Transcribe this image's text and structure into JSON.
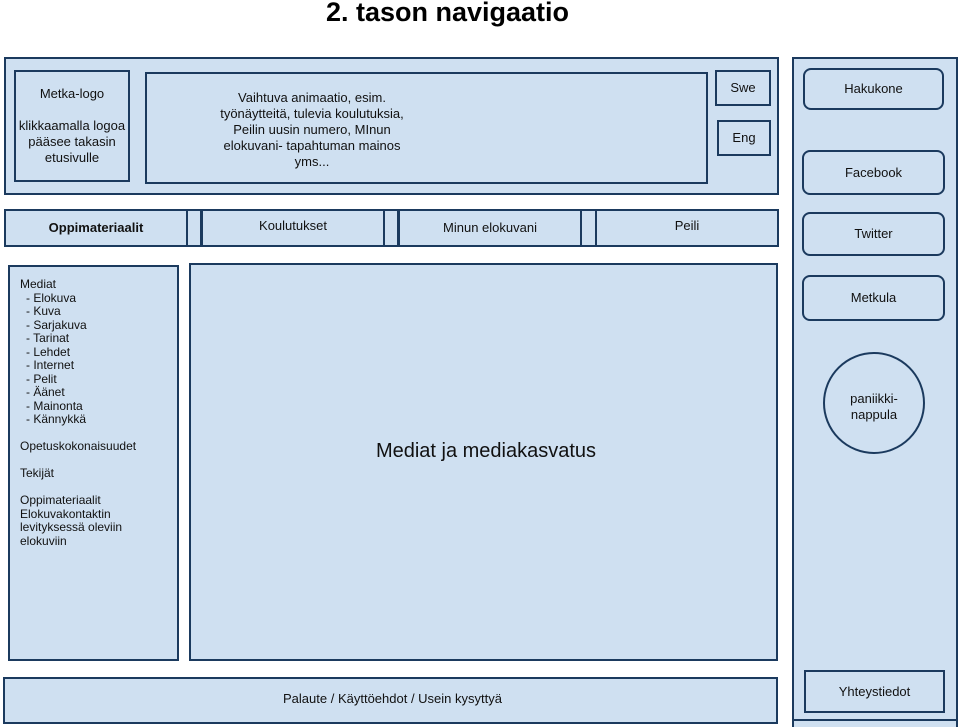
{
  "page_title": "2. tason navigaatio",
  "header": {
    "logo": {
      "title": "Metka-logo",
      "note_lines": [
        "klikkaamalla logoa",
        "pääsee takasin",
        "etusivulle"
      ]
    },
    "animation": {
      "lines": [
        "Vaihtuva animaatio, esim.",
        "työnäytteitä, tulevia koulutuksia,",
        "Peilin uusin numero, MInun",
        "elokuvani- tapahtuman mainos",
        "yms..."
      ]
    },
    "languages": [
      "Swe",
      "Eng"
    ]
  },
  "right_column": {
    "search": "Hakukone",
    "facebook": "Facebook",
    "twitter": "Twitter",
    "metkula": "Metkula",
    "panic_button_lines": [
      "paniikki-",
      "nappula"
    ],
    "contact": "Yhteystiedot"
  },
  "nav": {
    "items": [
      {
        "label": "Oppimateriaalit",
        "active": true
      },
      {
        "label": "Koulutukset",
        "active": false
      },
      {
        "label": "Minun elokuvani",
        "active": false
      },
      {
        "label": "Peili",
        "active": false
      }
    ]
  },
  "sidebar": {
    "media_heading": "Mediat",
    "media_items": [
      "- Elokuva",
      "- Kuva",
      "- Sarjakuva",
      "- Tarinat",
      "- Lehdet",
      "- Internet",
      "- Pelit",
      "- Äänet",
      "- Mainonta",
      "- Kännykkä"
    ],
    "sections": [
      "Opetuskokonaisuudet",
      "Tekijät"
    ],
    "materials_lines": [
      "Oppimateriaalit",
      "Elokuvakontaktin",
      "levityksessä oleviin",
      "elokuviin"
    ]
  },
  "main": {
    "title": "Mediat ja mediakasvatus"
  },
  "footer": {
    "links_text": "Palaute / Käyttöehdot / Usein kysyttyä"
  },
  "colors": {
    "box_fill": "#cfe0f1",
    "box_border": "#1b3a5e"
  }
}
